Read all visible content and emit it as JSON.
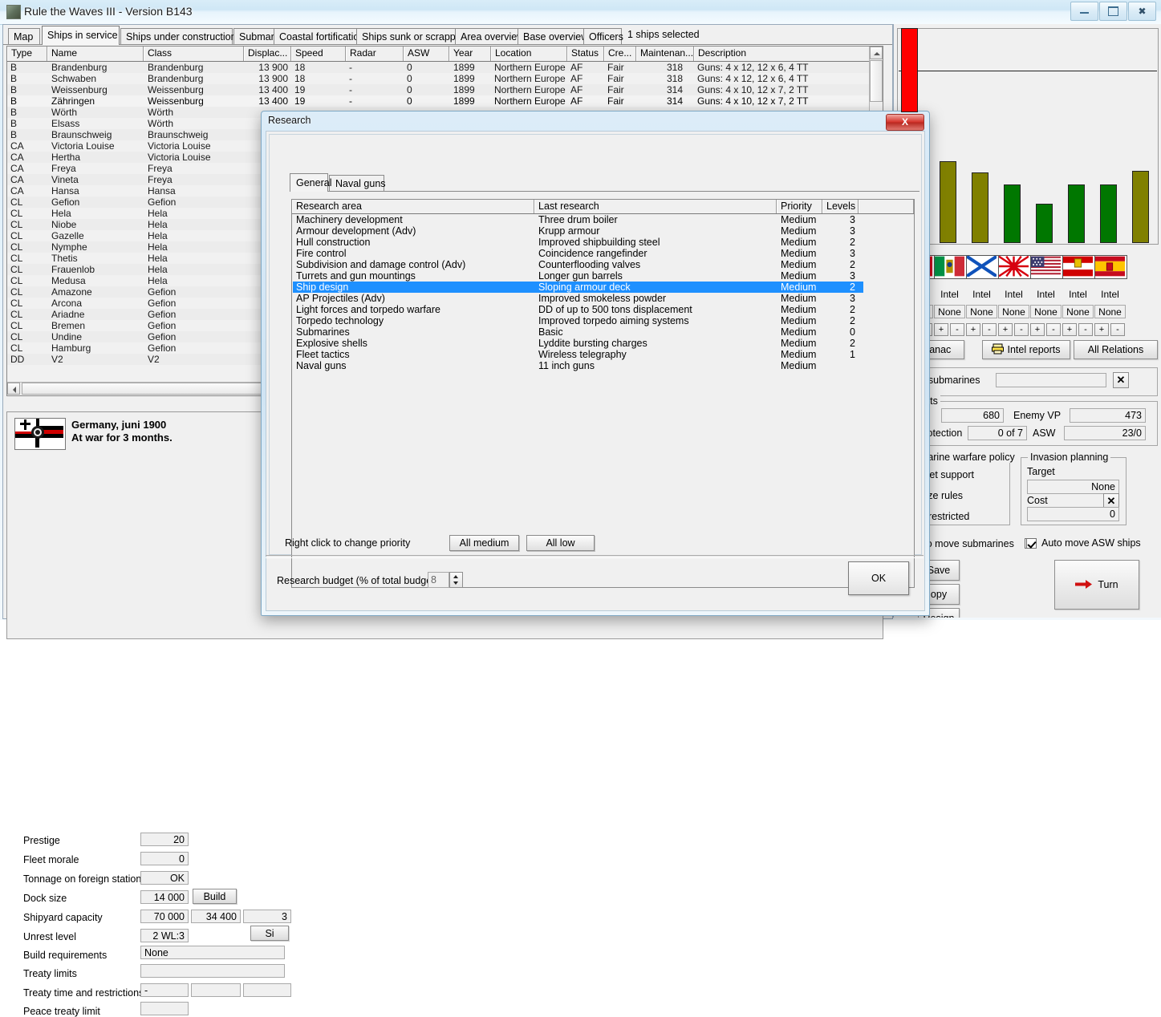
{
  "window": {
    "title": "Rule the Waves III - Version B143",
    "buttons": {
      "minimize": "minimize-button",
      "maximize": "maximize-button",
      "close": "close-button"
    }
  },
  "tabs": [
    {
      "label": "Map",
      "selected": false
    },
    {
      "label": "Ships in service",
      "selected": true
    },
    {
      "label": "Ships under construction",
      "selected": false
    },
    {
      "label": "Submarines",
      "selected": false
    },
    {
      "label": "Coastal fortifications",
      "selected": false
    },
    {
      "label": "Ships sunk or scrapped",
      "selected": false
    },
    {
      "label": "Area overview",
      "selected": false
    },
    {
      "label": "Base overview",
      "selected": false
    },
    {
      "label": "Officers",
      "selected": false
    }
  ],
  "selection_status": "1 ships selected",
  "ship_table": {
    "columns": [
      "Type",
      "Name",
      "Class",
      "Displac...",
      "Speed",
      "Radar",
      "ASW",
      "Year",
      "Location",
      "Status",
      "Cre...",
      "Maintenan...",
      "Description"
    ],
    "rows": [
      {
        "type": "B",
        "name": "Brandenburg",
        "class": "Brandenburg",
        "disp": "13 900",
        "speed": "18",
        "radar": "-",
        "asw": "0",
        "year": "1899",
        "location": "Northern Europe",
        "status": "AF",
        "crew": "Fair",
        "maint": "318",
        "desc": "Guns: 4 x 12, 12 x 6, 4 TT",
        "selected": false
      },
      {
        "type": "B",
        "name": "Schwaben",
        "class": "Brandenburg",
        "disp": "13 900",
        "speed": "18",
        "radar": "-",
        "asw": "0",
        "year": "1899",
        "location": "Northern Europe",
        "status": "AF",
        "crew": "Fair",
        "maint": "318",
        "desc": "Guns: 4 x 12, 12 x 6, 4 TT",
        "selected": false
      },
      {
        "type": "B",
        "name": "Weissenburg",
        "class": "Weissenburg",
        "disp": "13 400",
        "speed": "19",
        "radar": "-",
        "asw": "0",
        "year": "1899",
        "location": "Northern Europe",
        "status": "AF",
        "crew": "Fair",
        "maint": "314",
        "desc": "Guns: 4 x 10, 12 x 7, 2 TT",
        "selected": false
      },
      {
        "type": "B",
        "name": "Zähringen",
        "class": "Weissenburg",
        "disp": "13 400",
        "speed": "19",
        "radar": "-",
        "asw": "0",
        "year": "1899",
        "location": "Northern Europe",
        "status": "AF",
        "crew": "Fair",
        "maint": "314",
        "desc": "Guns: 4 x 10, 12 x 7, 2 TT",
        "selected": true
      },
      {
        "type": "B",
        "name": "Wörth",
        "class": "Wörth",
        "disp": "",
        "speed": "",
        "radar": "",
        "asw": "",
        "year": "",
        "location": "",
        "status": "",
        "crew": "",
        "maint": "",
        "desc": "",
        "selected": false
      },
      {
        "type": "B",
        "name": "Elsass",
        "class": "Wörth",
        "disp": "",
        "speed": "",
        "radar": "",
        "asw": "",
        "year": "",
        "location": "",
        "status": "",
        "crew": "",
        "maint": "",
        "desc": "",
        "selected": false
      },
      {
        "type": "B",
        "name": "Braunschweig",
        "class": "Braunschweig",
        "disp": "",
        "speed": "",
        "radar": "",
        "asw": "",
        "year": "",
        "location": "",
        "status": "",
        "crew": "",
        "maint": "",
        "desc": "",
        "selected": false
      },
      {
        "type": "CA",
        "name": "Victoria Louise",
        "class": "Victoria Louise",
        "disp": "",
        "speed": "",
        "radar": "",
        "asw": "",
        "year": "",
        "location": "",
        "status": "",
        "crew": "",
        "maint": "",
        "desc": "",
        "selected": false
      },
      {
        "type": "CA",
        "name": "Hertha",
        "class": "Victoria Louise",
        "disp": "",
        "speed": "",
        "radar": "",
        "asw": "",
        "year": "",
        "location": "",
        "status": "",
        "crew": "",
        "maint": "",
        "desc": "",
        "selected": false
      },
      {
        "type": "CA",
        "name": "Freya",
        "class": "Freya",
        "disp": "",
        "speed": "",
        "radar": "",
        "asw": "",
        "year": "",
        "location": "",
        "status": "",
        "crew": "",
        "maint": "",
        "desc": "",
        "selected": false
      },
      {
        "type": "CA",
        "name": "Vineta",
        "class": "Freya",
        "disp": "",
        "speed": "",
        "radar": "",
        "asw": "",
        "year": "",
        "location": "",
        "status": "",
        "crew": "",
        "maint": "",
        "desc": "",
        "selected": false
      },
      {
        "type": "CA",
        "name": "Hansa",
        "class": "Hansa",
        "disp": "",
        "speed": "",
        "radar": "",
        "asw": "",
        "year": "",
        "location": "",
        "status": "",
        "crew": "",
        "maint": "",
        "desc": "",
        "selected": false
      },
      {
        "type": "CL",
        "name": "Gefion",
        "class": "Gefion",
        "disp": "",
        "speed": "",
        "radar": "",
        "asw": "",
        "year": "",
        "location": "",
        "status": "",
        "crew": "",
        "maint": "",
        "desc": "",
        "selected": false
      },
      {
        "type": "CL",
        "name": "Hela",
        "class": "Hela",
        "disp": "",
        "speed": "",
        "radar": "",
        "asw": "",
        "year": "",
        "location": "",
        "status": "",
        "crew": "",
        "maint": "",
        "desc": "",
        "selected": false
      },
      {
        "type": "CL",
        "name": "Niobe",
        "class": "Hela",
        "disp": "",
        "speed": "",
        "radar": "",
        "asw": "",
        "year": "",
        "location": "",
        "status": "",
        "crew": "",
        "maint": "",
        "desc": "",
        "selected": false
      },
      {
        "type": "CL",
        "name": "Gazelle",
        "class": "Hela",
        "disp": "",
        "speed": "",
        "radar": "",
        "asw": "",
        "year": "",
        "location": "",
        "status": "",
        "crew": "",
        "maint": "",
        "desc": "",
        "selected": false
      },
      {
        "type": "CL",
        "name": "Nymphe",
        "class": "Hela",
        "disp": "",
        "speed": "",
        "radar": "",
        "asw": "",
        "year": "",
        "location": "",
        "status": "",
        "crew": "",
        "maint": "",
        "desc": "",
        "selected": false
      },
      {
        "type": "CL",
        "name": "Thetis",
        "class": "Hela",
        "disp": "",
        "speed": "",
        "radar": "",
        "asw": "",
        "year": "",
        "location": "",
        "status": "",
        "crew": "",
        "maint": "",
        "desc": "",
        "selected": false
      },
      {
        "type": "CL",
        "name": "Frauenlob",
        "class": "Hela",
        "disp": "",
        "speed": "",
        "radar": "",
        "asw": "",
        "year": "",
        "location": "",
        "status": "",
        "crew": "",
        "maint": "",
        "desc": "",
        "selected": false
      },
      {
        "type": "CL",
        "name": "Medusa",
        "class": "Hela",
        "disp": "",
        "speed": "",
        "radar": "",
        "asw": "",
        "year": "",
        "location": "",
        "status": "",
        "crew": "",
        "maint": "",
        "desc": "",
        "selected": false
      },
      {
        "type": "CL",
        "name": "Amazone",
        "class": "Gefion",
        "disp": "",
        "speed": "",
        "radar": "",
        "asw": "",
        "year": "",
        "location": "",
        "status": "",
        "crew": "",
        "maint": "",
        "desc": "",
        "selected": false
      },
      {
        "type": "CL",
        "name": "Arcona",
        "class": "Gefion",
        "disp": "",
        "speed": "",
        "radar": "",
        "asw": "",
        "year": "",
        "location": "",
        "status": "",
        "crew": "",
        "maint": "",
        "desc": "",
        "selected": false
      },
      {
        "type": "CL",
        "name": "Ariadne",
        "class": "Gefion",
        "disp": "",
        "speed": "",
        "radar": "",
        "asw": "",
        "year": "",
        "location": "",
        "status": "",
        "crew": "",
        "maint": "",
        "desc": "",
        "selected": false
      },
      {
        "type": "CL",
        "name": "Bremen",
        "class": "Gefion",
        "disp": "",
        "speed": "",
        "radar": "",
        "asw": "",
        "year": "",
        "location": "",
        "status": "",
        "crew": "",
        "maint": "",
        "desc": "",
        "selected": false
      },
      {
        "type": "CL",
        "name": "Undine",
        "class": "Gefion",
        "disp": "",
        "speed": "",
        "radar": "",
        "asw": "",
        "year": "",
        "location": "",
        "status": "",
        "crew": "",
        "maint": "",
        "desc": "",
        "selected": false
      },
      {
        "type": "CL",
        "name": "Hamburg",
        "class": "Gefion",
        "disp": "",
        "speed": "",
        "radar": "",
        "asw": "",
        "year": "",
        "location": "",
        "status": "",
        "crew": "",
        "maint": "",
        "desc": "",
        "selected": false
      },
      {
        "type": "DD",
        "name": "V2",
        "class": "V2",
        "disp": "",
        "speed": "",
        "radar": "",
        "asw": "",
        "year": "",
        "location": "",
        "status": "",
        "crew": "",
        "maint": "",
        "desc": "",
        "selected": false
      }
    ]
  },
  "nation": {
    "name": "Germany, juni 1900",
    "war_status": "At war for 3 months.",
    "fields": [
      {
        "label": "Prestige",
        "value": "20"
      },
      {
        "label": "Fleet morale",
        "value": "0"
      },
      {
        "label": "Tonnage on foreign stations",
        "value": "OK"
      },
      {
        "label": "Dock size",
        "value": "14 000"
      },
      {
        "label": "Shipyard capacity",
        "value": "70 000"
      },
      {
        "label": "Unrest level",
        "value": "2 WL:3"
      },
      {
        "label": "Build requirements",
        "value": "None"
      },
      {
        "label": "Treaty limits",
        "value": ""
      },
      {
        "label": "Treaty time and restrictions",
        "value": "-"
      },
      {
        "label": "Peace treaty limit",
        "value": ""
      }
    ],
    "build_button": "Build",
    "shipyard_second": "34 400",
    "shipyard_third": "3",
    "size_button": "Si"
  },
  "right_panel": {
    "nations": [
      {
        "flag": "france-flag",
        "intel_label": "Intel",
        "intel_value": "None",
        "plus": "+",
        "minus": "-"
      },
      {
        "flag": "italy-flag",
        "intel_label": "Intel",
        "intel_value": "None",
        "plus": "+",
        "minus": "-"
      },
      {
        "flag": "russia-flag",
        "intel_label": "Intel",
        "intel_value": "None",
        "plus": "+",
        "minus": "-"
      },
      {
        "flag": "japan-flag",
        "intel_label": "Intel",
        "intel_value": "None",
        "plus": "+",
        "minus": "-"
      },
      {
        "flag": "usa-flag",
        "intel_label": "Intel",
        "intel_value": "None",
        "plus": "+",
        "minus": "-"
      },
      {
        "flag": "austria-hungary-flag",
        "intel_label": "Intel",
        "intel_value": "None",
        "plus": "+",
        "minus": "-"
      },
      {
        "flag": "spain-flag",
        "intel_label": "Intel",
        "intel_value": "None",
        "plus": "+",
        "minus": "-"
      }
    ],
    "almanac_button": "Almanac",
    "intel_reports_button": "Intel reports",
    "all_relations_button": "All Relations",
    "build_submarines_label": "build submarines",
    "build_submarines_value": "",
    "results_group": "results",
    "own_vp": "680",
    "enemy_vp_label": "Enemy VP",
    "enemy_vp": "473",
    "trade_protection_label": "de protection",
    "trade_protection": "0 of 7",
    "asw_label": "ASW",
    "asw_value": "23/0",
    "sub_policy_group": "ubmarine warfare policy",
    "sub_policy_options": [
      "Fleet support",
      "Prize rules",
      "Unrestricted"
    ],
    "invasion_group": "Invasion planning",
    "invasion_target_label": "Target",
    "invasion_target": "None",
    "invasion_cost_label": "Cost",
    "invasion_cost": "0",
    "auto_move_subs": "Auto move submarines",
    "auto_move_asw": "Auto move ASW ships",
    "auto_move_asw_checked": true,
    "save_button": "Save",
    "copy_game_button": "opy game",
    "resign_button": "Resign",
    "turn_button": "Turn"
  },
  "chart_data": {
    "type": "bar",
    "title": "",
    "categories": [
      "Germany",
      "France",
      "Italy",
      "Russia",
      "Japan",
      "USA",
      "Austria-Hungary",
      "Spain"
    ],
    "values": [
      100,
      42,
      36,
      30,
      20,
      30,
      30,
      37
    ],
    "colors": [
      "#fe0000",
      "#808000",
      "#808000",
      "#007700",
      "#007700",
      "#007700",
      "#007700",
      "#808000"
    ],
    "ylim": [
      0,
      110
    ],
    "xlabel": "",
    "ylabel": "",
    "gridline_at": 88,
    "legend": ""
  },
  "research_dialog": {
    "title": "Research",
    "close_label": "X",
    "tabs": [
      {
        "label": "General",
        "selected": true
      },
      {
        "label": "Naval guns",
        "selected": false
      }
    ],
    "columns": [
      "Research area",
      "Last research",
      "Priority",
      "Levels"
    ],
    "rows": [
      {
        "area": "Machinery development",
        "last": "Three drum boiler",
        "priority": "Medium",
        "levels": "3",
        "selected": false
      },
      {
        "area": "Armour development (Adv)",
        "last": "Krupp armour",
        "priority": "Medium",
        "levels": "3",
        "selected": false
      },
      {
        "area": "Hull construction",
        "last": "Improved shipbuilding steel",
        "priority": "Medium",
        "levels": "2",
        "selected": false
      },
      {
        "area": "Fire control",
        "last": "Coincidence rangefinder",
        "priority": "Medium",
        "levels": "3",
        "selected": false
      },
      {
        "area": "Subdivision and damage control (Adv)",
        "last": "Counterflooding valves",
        "priority": "Medium",
        "levels": "2",
        "selected": false
      },
      {
        "area": "Turrets and gun mountings",
        "last": "Longer gun barrels",
        "priority": "Medium",
        "levels": "3",
        "selected": false
      },
      {
        "area": "Ship design",
        "last": "Sloping armour deck",
        "priority": "Medium",
        "levels": "2",
        "selected": true
      },
      {
        "area": "AP Projectiles (Adv)",
        "last": "Improved smokeless powder",
        "priority": "Medium",
        "levels": "3",
        "selected": false
      },
      {
        "area": "Light forces and torpedo warfare",
        "last": "DD of up to 500 tons displacement",
        "priority": "Medium",
        "levels": "2",
        "selected": false
      },
      {
        "area": "Torpedo technology",
        "last": "Improved torpedo aiming systems",
        "priority": "Medium",
        "levels": "2",
        "selected": false
      },
      {
        "area": "Submarines",
        "last": "Basic",
        "priority": "Medium",
        "levels": "0",
        "selected": false
      },
      {
        "area": "Explosive shells",
        "last": "Lyddite bursting charges",
        "priority": "Medium",
        "levels": "2",
        "selected": false
      },
      {
        "area": "Fleet tactics",
        "last": "Wireless telegraphy",
        "priority": "Medium",
        "levels": "1",
        "selected": false
      },
      {
        "area": "Naval guns",
        "last": "11 inch guns",
        "priority": "Medium",
        "levels": "",
        "selected": false
      }
    ],
    "hint": "Right click to change priority",
    "all_medium_button": "All medium",
    "all_low_button": "All low",
    "budget_label": "Research budget (% of total budget)",
    "budget_value": "8",
    "ok_button": "OK"
  }
}
